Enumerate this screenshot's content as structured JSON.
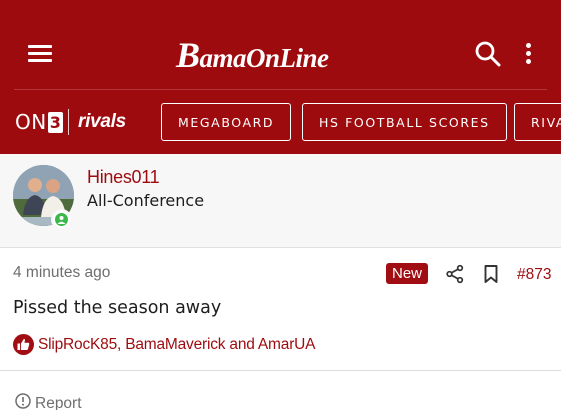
{
  "header": {
    "logo_text_prefix": "B",
    "logo_text_rest": "amaOnLine",
    "brand_color": "#9e0b0f"
  },
  "network": {
    "on3_text": "ON",
    "on3_badge": "3",
    "rivals_text": "rivals",
    "nav_pills": [
      {
        "label": "MEGABOARD"
      },
      {
        "label": "HS FOOTBALL SCORES"
      },
      {
        "label": "RIVALS"
      }
    ]
  },
  "author": {
    "username": "Hines011",
    "user_title": "All-Conference",
    "online_indicator_color": "#3cb84a"
  },
  "post": {
    "timestamp": "4 minutes ago",
    "new_badge": "New",
    "post_number": "#873",
    "message": "Pissed the season away",
    "likes_text": "SlipRocK85, BamaMaverick and AmarUA",
    "report_label": "Report"
  },
  "icons": {
    "menu": "hamburger-menu-icon",
    "search": "search-icon",
    "more": "more-vertical-icon",
    "share": "share-icon",
    "bookmark": "bookmark-icon",
    "like": "thumbs-up-icon",
    "report": "report-icon",
    "online": "online-status-icon"
  }
}
